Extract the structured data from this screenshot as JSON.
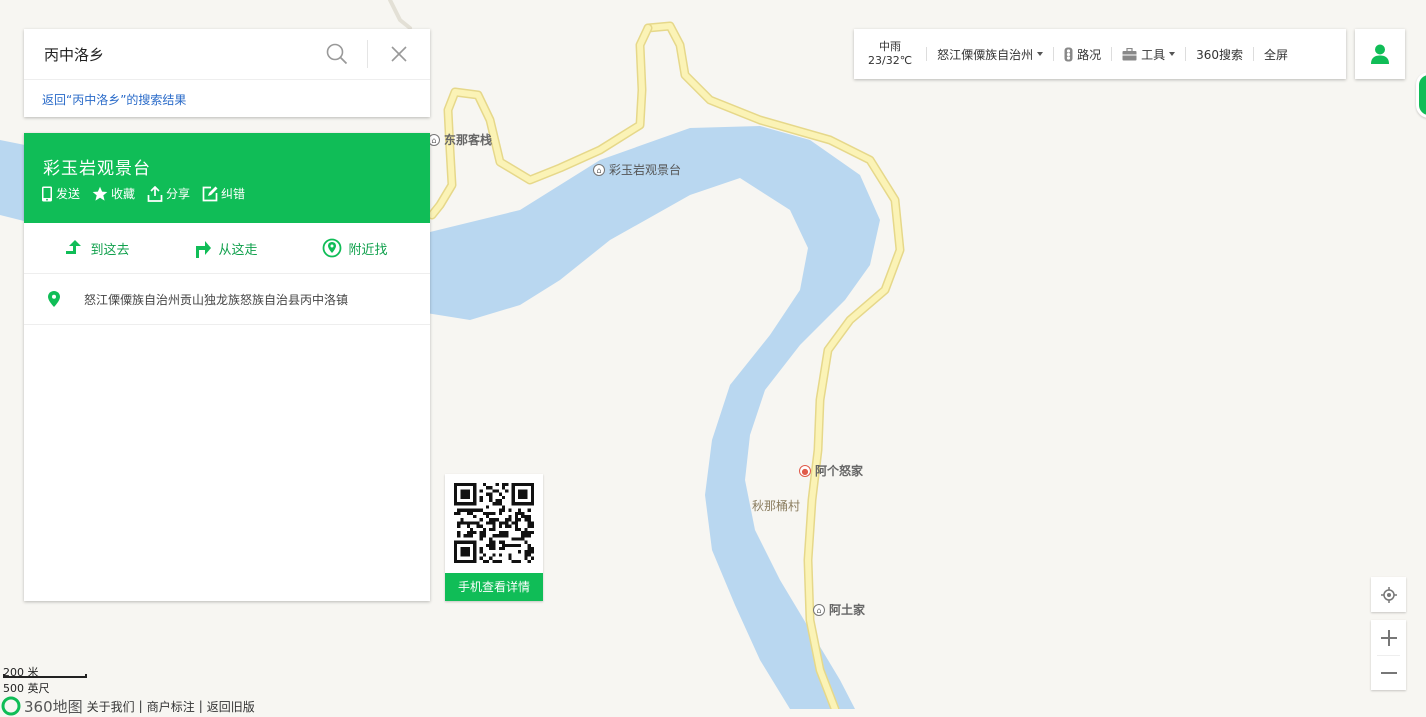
{
  "search": {
    "query": "丙中洛乡",
    "back_link": "返回“丙中洛乡”的搜索结果"
  },
  "result": {
    "title": "彩玉岩观景台",
    "actions": [
      "发送",
      "收藏",
      "分享",
      "纠错"
    ],
    "routes": [
      "到这去",
      "从这走",
      "附近找"
    ],
    "address": "怒江傈僳族自治州贡山独龙族怒族自治县丙中洛镇"
  },
  "qr": {
    "label": "手机查看详情"
  },
  "toolbar": {
    "weather_desc": "中雨",
    "weather_temp": "23/32℃",
    "region": "怒江傈僳族自治州",
    "traffic": "路况",
    "tools": "工具",
    "search360": "360搜索",
    "fullscreen": "全屏"
  },
  "map_labels": {
    "poi_dongna": "东那客栈",
    "poi_caiyuyan": "彩玉岩观景台",
    "poi_agenujia": "阿个怒家",
    "village_qiunatong": "秋那桶村",
    "poi_atujia": "阿土家"
  },
  "scale": {
    "metric": "200 米",
    "imperial": "500 英尺"
  },
  "footer": {
    "brand": "360地图",
    "links": [
      "关于我们",
      "商户标注",
      "返回旧版"
    ]
  },
  "colors": {
    "accent": "#10bd57",
    "river": "#b9d7f0",
    "road": "#fbf3b6",
    "land": "#f7f6f2"
  }
}
